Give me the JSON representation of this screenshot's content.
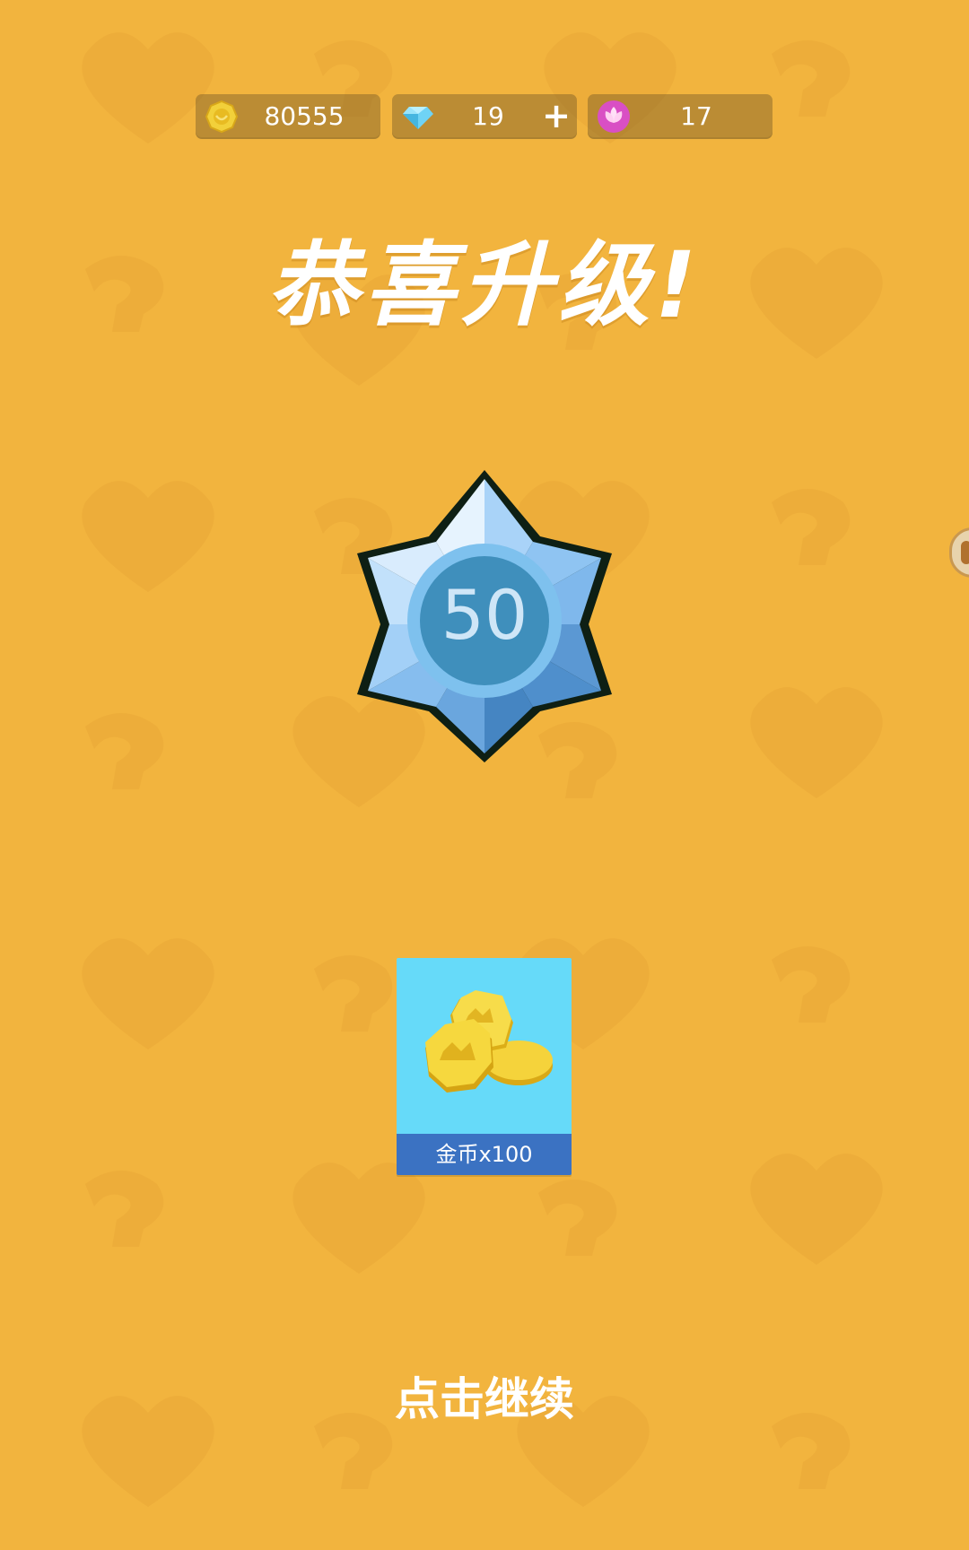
{
  "resources": {
    "coins": {
      "icon": "coin-icon",
      "value": "80555"
    },
    "gems": {
      "icon": "diamond-icon",
      "value": "19",
      "add_label": "+"
    },
    "flowers": {
      "icon": "lotus-icon",
      "value": "17"
    }
  },
  "title": "恭喜升级!",
  "level_badge": {
    "level": "50",
    "icon": "star-badge-icon"
  },
  "reward": {
    "icon": "gold-coins-icon",
    "label": "金币x100"
  },
  "continue_label": "点击继续",
  "colors": {
    "background": "#f2b43e",
    "card_background": "#66daf9",
    "card_label_background": "#3b72c2",
    "badge_light": "#c4e2fb",
    "badge_dark": "#5a97d2"
  }
}
